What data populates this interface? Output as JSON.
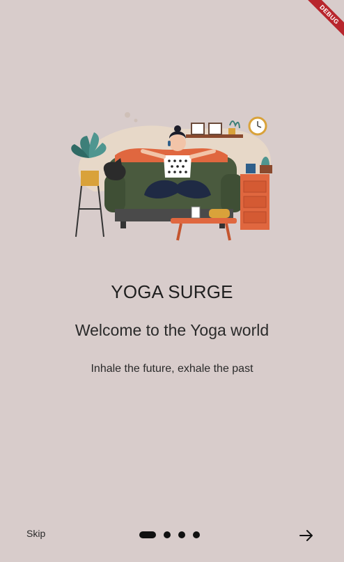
{
  "app": {
    "debug_banner": "DEBUG"
  },
  "onboarding": {
    "title": "YOGA SURGE",
    "subtitle": "Welcome to the Yoga world",
    "tagline": "Inhale the future, exhale the past",
    "page_index": 1,
    "page_count": 4
  },
  "footer": {
    "skip_label": "Skip",
    "next_icon": "arrow-right-icon"
  },
  "colors": {
    "background": "#d8cccb",
    "sofa": "#4a5a3e",
    "accent_orange": "#e0673f",
    "debug_red": "#b8262d"
  }
}
